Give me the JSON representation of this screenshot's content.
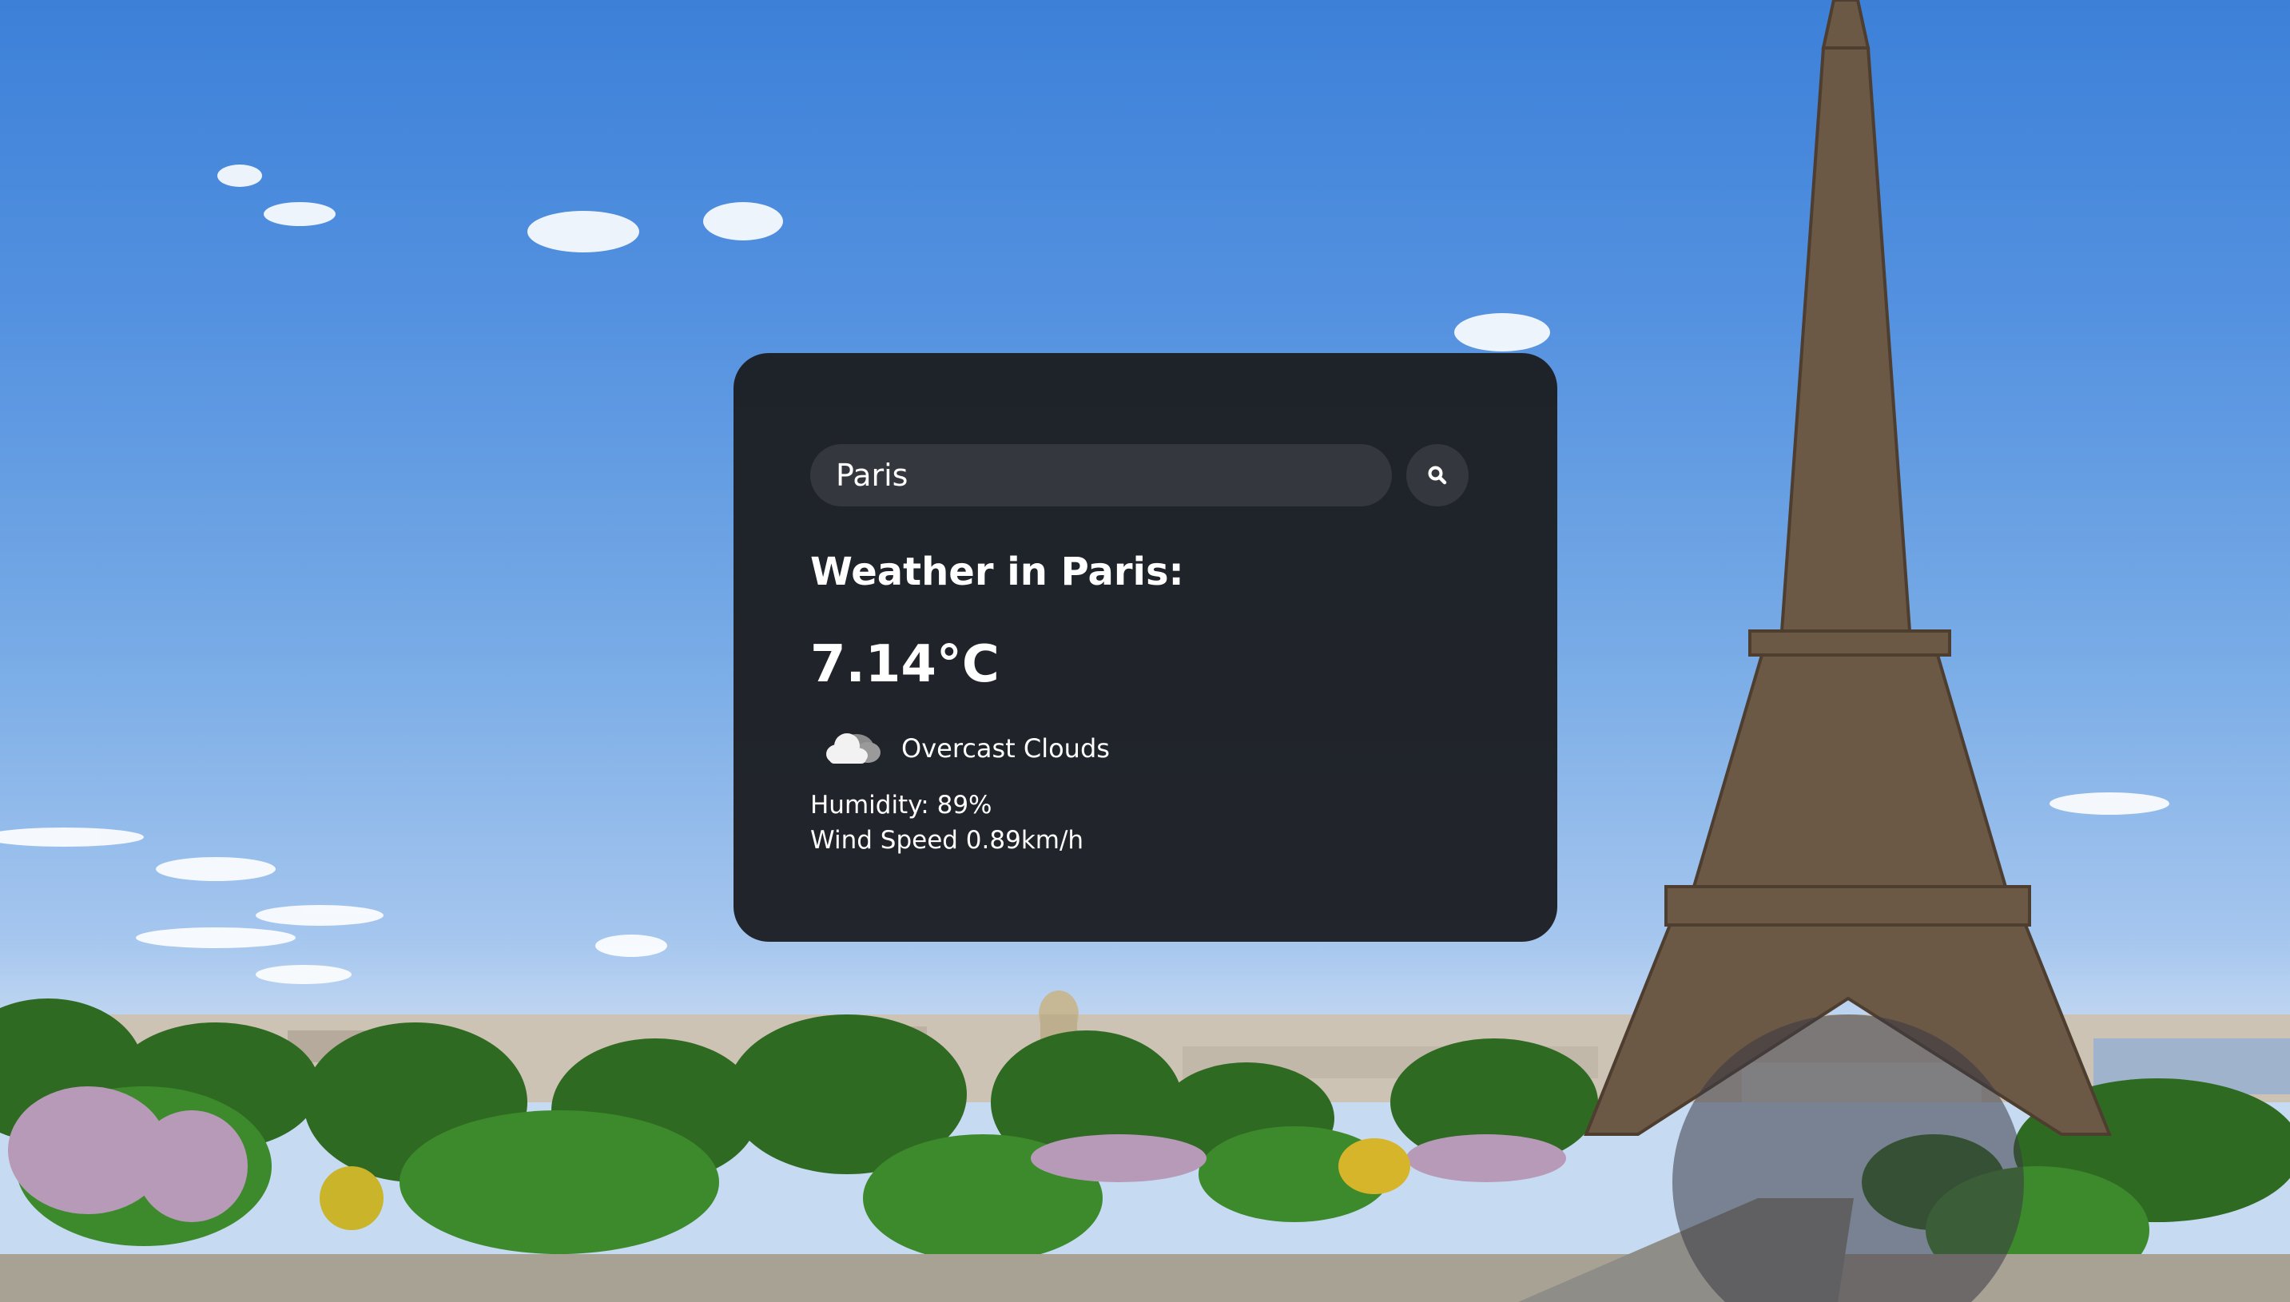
{
  "search": {
    "value": "Paris",
    "button_icon": "search-icon"
  },
  "weather": {
    "title": "Weather in Paris:",
    "temperature": "7.14°C",
    "description": "Overcast Clouds",
    "description_icon": "overcast-clouds-icon",
    "humidity": "Humidity: 89%",
    "wind": "Wind Speed 0.89km/h"
  },
  "colors": {
    "card_background": "#1c1e22",
    "input_background": "#34373d",
    "text": "#ffffff",
    "sky": "#5592e0"
  }
}
